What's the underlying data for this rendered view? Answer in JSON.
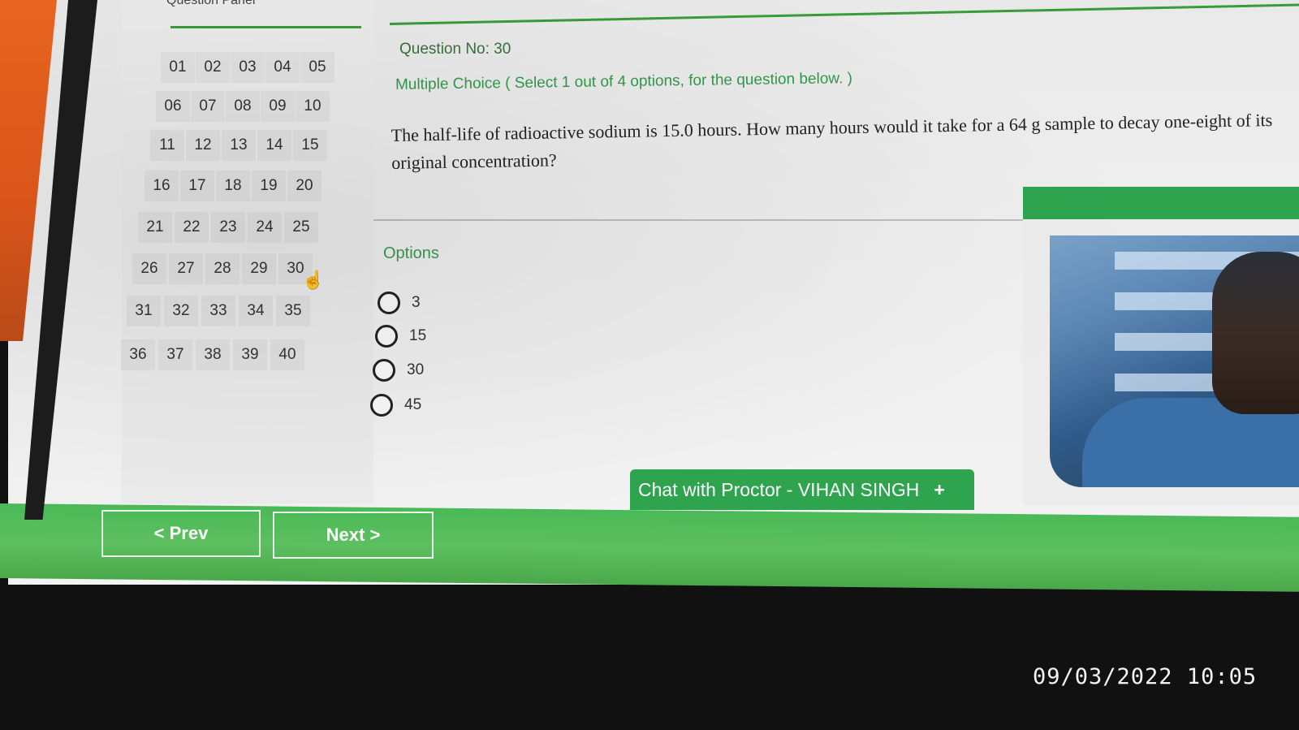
{
  "question_panel": {
    "title": "Question Panel",
    "numbers": [
      "01",
      "02",
      "03",
      "04",
      "05",
      "06",
      "07",
      "08",
      "09",
      "10",
      "11",
      "12",
      "13",
      "14",
      "15",
      "16",
      "17",
      "18",
      "19",
      "20",
      "21",
      "22",
      "23",
      "24",
      "25",
      "26",
      "27",
      "28",
      "29",
      "30",
      "31",
      "32",
      "33",
      "34",
      "35",
      "36",
      "37",
      "38",
      "39",
      "40"
    ]
  },
  "question": {
    "number_label": "Question No: 30",
    "type_label": "Multiple Choice ( Select 1 out of 4 options, for the question below. )",
    "text": "The half-life of radioactive sodium is 15.0 hours. How many hours would it take for a 64 g sample to decay one-eight of its original concentration?"
  },
  "options": {
    "label": "Options",
    "items": [
      "3",
      "15",
      "30",
      "45"
    ]
  },
  "chat": {
    "label": "Chat with Proctor - VIHAN SINGH",
    "plus": "+"
  },
  "navigation": {
    "prev_label": "< Prev",
    "next_label": "Next >"
  },
  "camera_timestamp": "09/03/2022 10:05",
  "colors": {
    "accent_green": "#2ea44f",
    "bar_green": "#4ab957",
    "page_bg": "#efefef"
  }
}
